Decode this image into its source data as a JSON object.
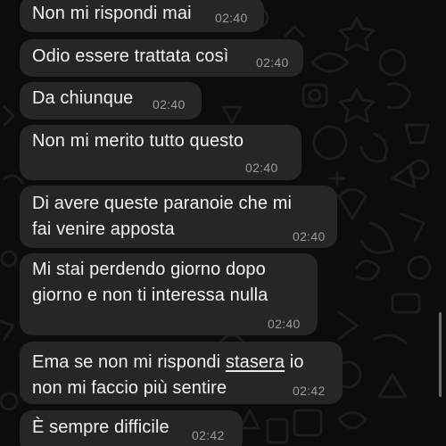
{
  "messages": [
    {
      "text": "Non mi rispondi mai",
      "time": "02:40"
    },
    {
      "text": "Odio essere trattata così",
      "time": "02:40"
    },
    {
      "text": "Da chiunque",
      "time": "02:40"
    },
    {
      "text": "Non mi merito tutto questo",
      "time": "02:40"
    },
    {
      "line1": "Di avere queste paranoie che mi",
      "line2": "fai venire apposta",
      "time": "02:40"
    },
    {
      "line1": "Mi stai perdendo giorno dopo",
      "line2": "giorno e non ti interessa nulla",
      "time": "02:40"
    },
    {
      "line1_pre": "Ema se non mi rispondi ",
      "line1_link": "stasera",
      "line1_post": " io",
      "line2": "non mi faccio più sentire",
      "time": "02:42"
    },
    {
      "text": "È sempre difficile",
      "time": "02:42"
    }
  ]
}
